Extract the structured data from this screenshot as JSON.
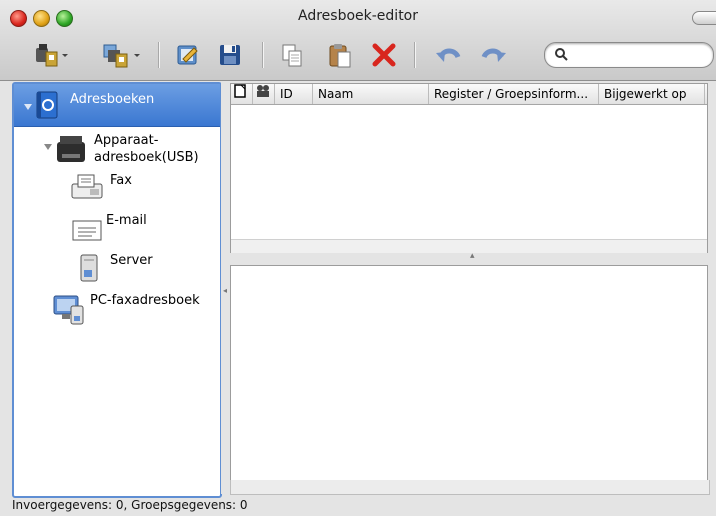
{
  "window": {
    "title": "Adresboek-editor"
  },
  "toolbar": {
    "items": [
      {
        "name": "new-contact-icon"
      },
      {
        "name": "new-group-icon"
      },
      {
        "name": "edit-icon"
      },
      {
        "name": "save-icon"
      },
      {
        "name": "copy-icon"
      },
      {
        "name": "paste-icon"
      },
      {
        "name": "delete-icon"
      },
      {
        "name": "undo-icon"
      },
      {
        "name": "redo-icon"
      }
    ],
    "search_placeholder": ""
  },
  "sidebar": {
    "root": "Adresboeken",
    "device": "Apparaat-\nadresboek(USB)",
    "fax": "Fax",
    "email": "E-mail",
    "server": "Server",
    "pc_fax": "PC-faxadresboek"
  },
  "table": {
    "columns": [
      "ID",
      "Naam",
      "Register / Groepsinform...",
      "Bijgewerkt op"
    ]
  },
  "status": {
    "text": "Invoergegevens: 0, Groepsgegevens: 0"
  },
  "colors": {
    "selection": "#3a77d1",
    "accent_border": "#5f8ed3"
  }
}
